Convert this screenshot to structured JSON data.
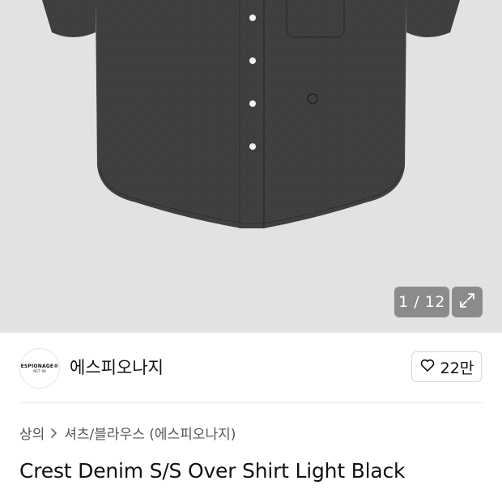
{
  "gallery": {
    "counter_text": "1 / 12",
    "current_index": 1,
    "total_images": 12,
    "expand_icon": "expand-icon"
  },
  "brand": {
    "logo_text": "ESPIONAGE®",
    "logo_subtext": "NST' 98",
    "name": "에스피오나지"
  },
  "like": {
    "icon": "heart-outline-icon",
    "count": "22만"
  },
  "breadcrumb": {
    "items": [
      "상의",
      "셔츠/블라우스 (에스피오나지)"
    ],
    "separator_icon": "chevron-right-icon"
  },
  "product": {
    "title": "Crest Denim S/S Over Shirt Light Black"
  },
  "colors": {
    "gallery_bg": "#e2e2e2",
    "shirt": "#3a3a3a",
    "overlay_button": "#787878"
  }
}
